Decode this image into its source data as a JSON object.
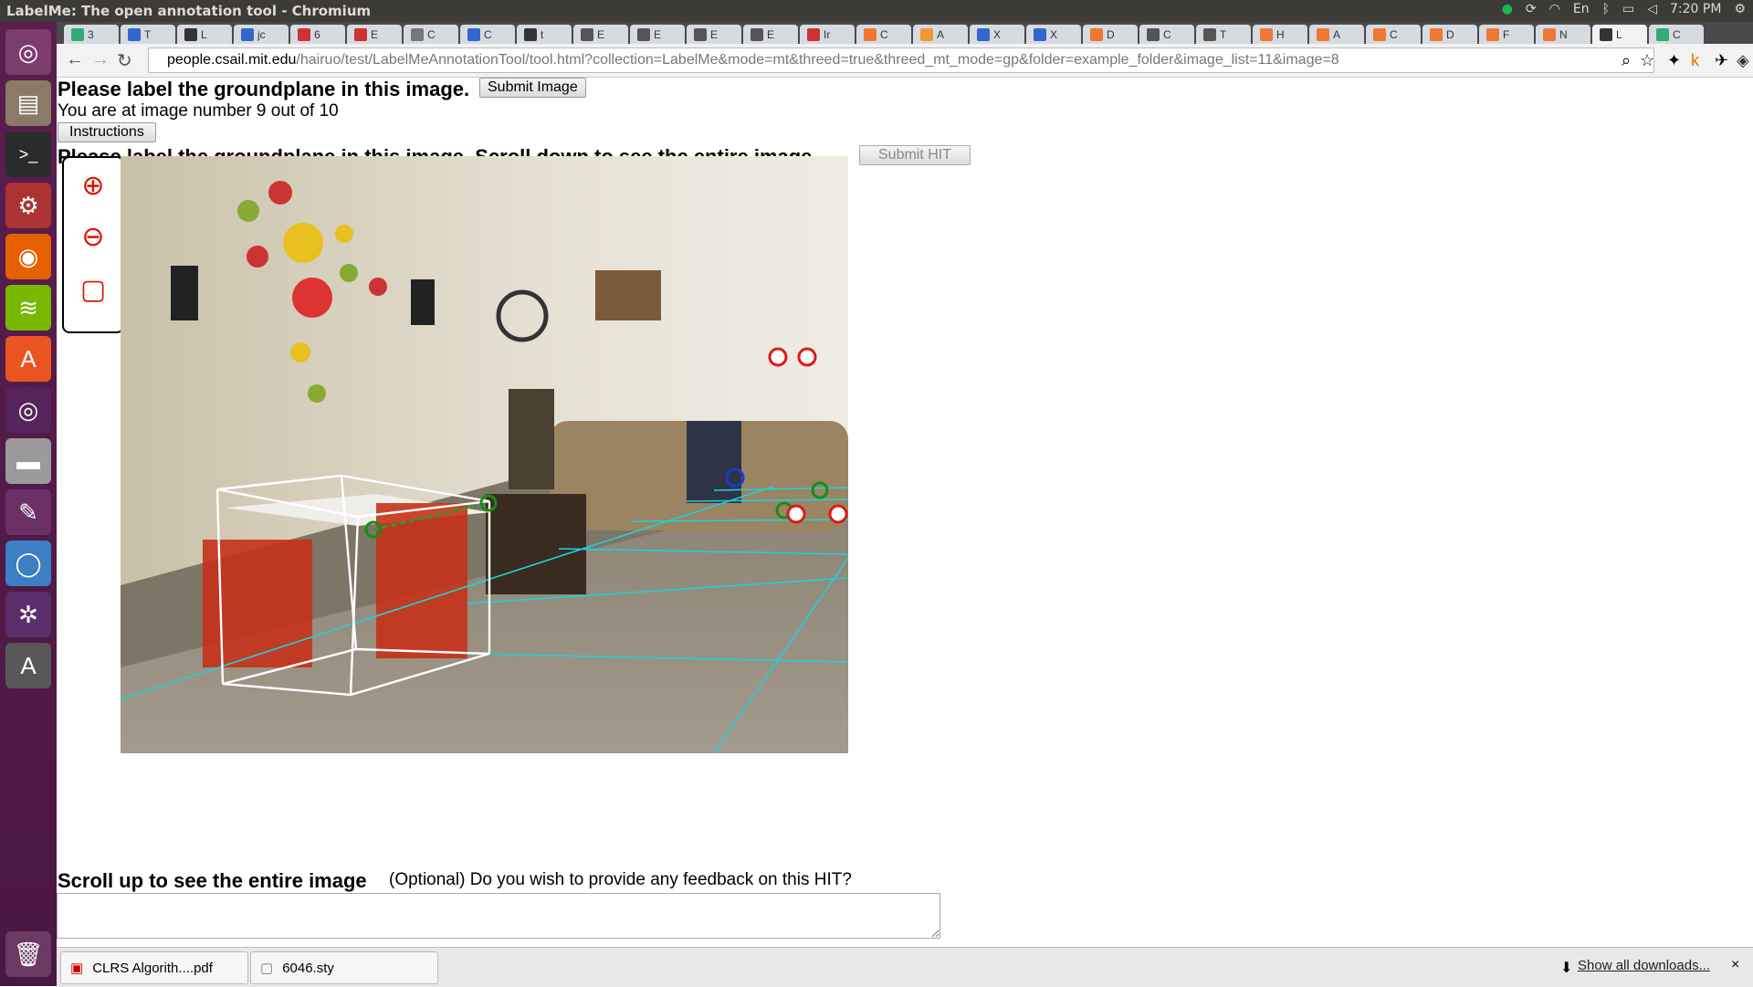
{
  "window": {
    "title": "LabelMe: The open annotation tool - Chromium",
    "clock": "7:20 PM",
    "keyboard": "En"
  },
  "tabs": [
    {
      "label": "3",
      "color": "#3a7"
    },
    {
      "label": "T",
      "color": "#36c"
    },
    {
      "label": "L",
      "color": "#333"
    },
    {
      "label": "jc",
      "color": "#36c"
    },
    {
      "label": "6",
      "color": "#c33"
    },
    {
      "label": "E",
      "color": "#c33"
    },
    {
      "label": "C",
      "color": "#777"
    },
    {
      "label": "C",
      "color": "#36c"
    },
    {
      "label": "t",
      "color": "#333"
    },
    {
      "label": "E",
      "color": "#555"
    },
    {
      "label": "E",
      "color": "#555"
    },
    {
      "label": "E",
      "color": "#555"
    },
    {
      "label": "E",
      "color": "#555"
    },
    {
      "label": "Ir",
      "color": "#c33"
    },
    {
      "label": "C",
      "color": "#e73"
    },
    {
      "label": "A",
      "color": "#e93"
    },
    {
      "label": "X",
      "color": "#36c"
    },
    {
      "label": "X",
      "color": "#36c"
    },
    {
      "label": "D",
      "color": "#e73"
    },
    {
      "label": "C",
      "color": "#555"
    },
    {
      "label": "T",
      "color": "#555"
    },
    {
      "label": "H",
      "color": "#e73"
    },
    {
      "label": "A",
      "color": "#e73"
    },
    {
      "label": "C",
      "color": "#e73"
    },
    {
      "label": "D",
      "color": "#e73"
    },
    {
      "label": "F",
      "color": "#e73"
    },
    {
      "label": "N",
      "color": "#e73"
    },
    {
      "label": "L",
      "color": "#333",
      "active": true
    },
    {
      "label": "C",
      "color": "#3a7"
    }
  ],
  "address": {
    "host": "people.csail.mit.edu",
    "path": "/hairuo/test/LabelMeAnnotationTool/tool.html?collection=LabelMe&mode=mt&threed=true&threed_mt_mode=gp&folder=example_folder&image_list=11&image=8"
  },
  "page": {
    "heading": "Please label the groundplane in this image.",
    "submit_image": "Submit Image",
    "progress": "You are at image number 9 out of 10",
    "instructions": "Instructions",
    "subheading": "Please label the groundplane in this image. Scroll down to see the entire image.",
    "submit_hit": "Submit HIT",
    "scroll_hint": "Scroll up to see the entire image",
    "feedback_label": "(Optional) Do you wish to provide any feedback on this HIT?",
    "feedback_value": ""
  },
  "tools": [
    {
      "name": "zoom-in-icon",
      "glyph": "⊕"
    },
    {
      "name": "zoom-out-icon",
      "glyph": "⊖"
    },
    {
      "name": "fit-image-icon",
      "glyph": "▢"
    }
  ],
  "downloads": {
    "items": [
      {
        "label": "CLRS Algorith....pdf"
      },
      {
        "label": "6046.sty"
      }
    ],
    "show_all": "Show all downloads..."
  }
}
